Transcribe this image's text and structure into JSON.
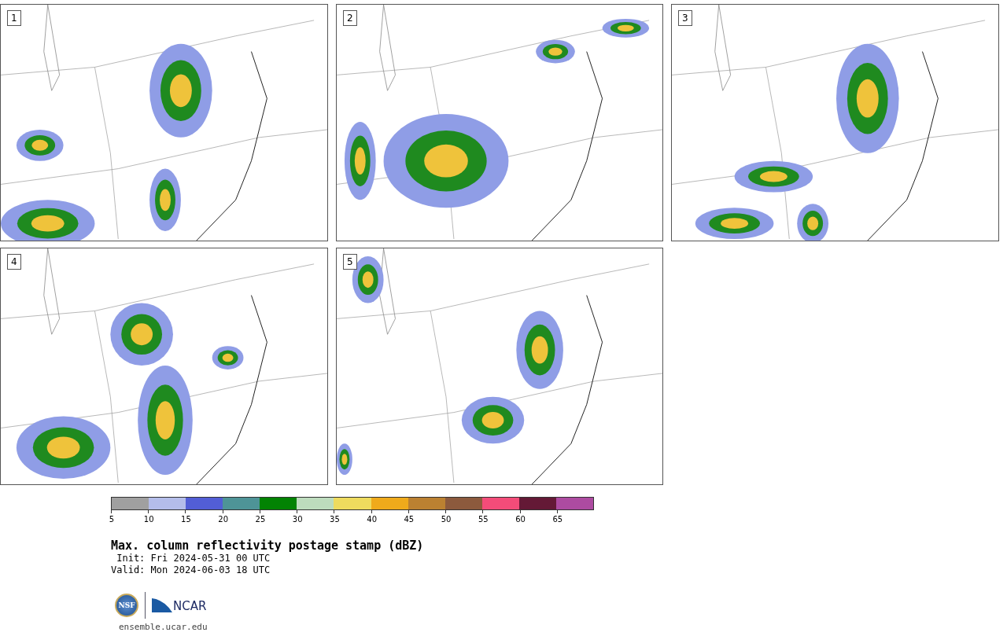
{
  "panels": [
    {
      "label": "1"
    },
    {
      "label": "2"
    },
    {
      "label": "3"
    },
    {
      "label": "4"
    },
    {
      "label": "5"
    }
  ],
  "colorbar": {
    "segments": [
      {
        "color": "#a0a0a0"
      },
      {
        "color": "#b4bdea"
      },
      {
        "color": "#525ed6"
      },
      {
        "color": "#4e9497"
      },
      {
        "color": "#028303"
      },
      {
        "color": "#bddcbd"
      },
      {
        "color": "#eedb5e"
      },
      {
        "color": "#efaa1b"
      },
      {
        "color": "#bb8131"
      },
      {
        "color": "#8c5a3d"
      },
      {
        "color": "#f34c79"
      },
      {
        "color": "#641936"
      },
      {
        "color": "#ad4ba1"
      }
    ],
    "ticks": [
      "5",
      "10",
      "15",
      "20",
      "25",
      "30",
      "35",
      "40",
      "45",
      "50",
      "55",
      "60",
      "65"
    ]
  },
  "title": "Max. column reflectivity postage stamp (dBZ)",
  "init": " Init: Fri 2024-05-31 00 UTC",
  "valid": "Valid: Mon 2024-06-03 18 UTC",
  "logo": {
    "nsf": "NSF",
    "ncar": "NCAR"
  },
  "site": "ensemble.ucar.edu"
}
